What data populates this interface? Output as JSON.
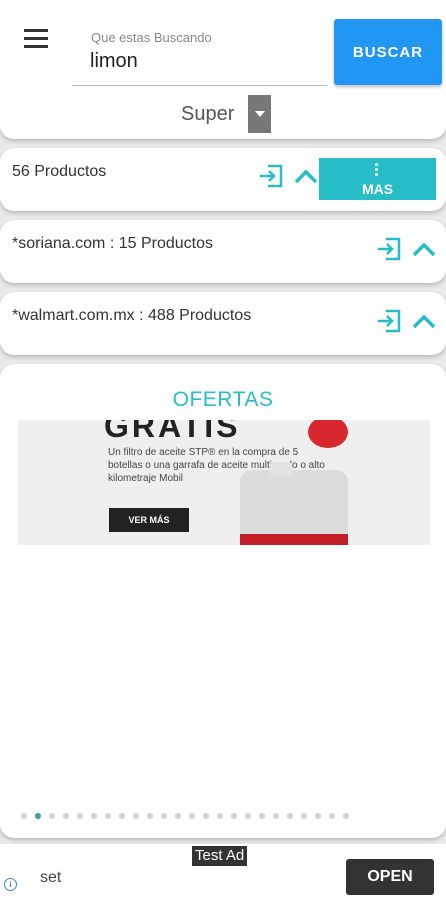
{
  "search": {
    "label": "Que estas Buscando",
    "value": "limon",
    "button": "BUSCAR",
    "store": "Super"
  },
  "results": [
    {
      "label": "56 Productos",
      "more": "MAS"
    },
    {
      "label": "*soriana.com : 15 Productos"
    },
    {
      "label": "*walmart.com.mx : 488 Productos"
    }
  ],
  "ofertas": {
    "title": "OFERTAS",
    "banner": {
      "heading": "GRATIS",
      "body": "Un filtro de aceite STP® en la compra de 5 botellas o una garrafa de aceite multigrado o alto kilometraje Mobil",
      "button": "VER MÁS"
    },
    "carousel": {
      "count": 24,
      "active_index": 1
    }
  },
  "ad": {
    "badge": "Test Ad",
    "text": "set",
    "button": "OPEN"
  },
  "colors": {
    "accent": "#26bdc7",
    "primary_button": "#2196f3"
  },
  "icons": {
    "menu": "menu-icon",
    "enter": "enter-icon",
    "collapse": "chevron-up-icon",
    "more": "more-vert-icon",
    "info": "info-icon"
  }
}
